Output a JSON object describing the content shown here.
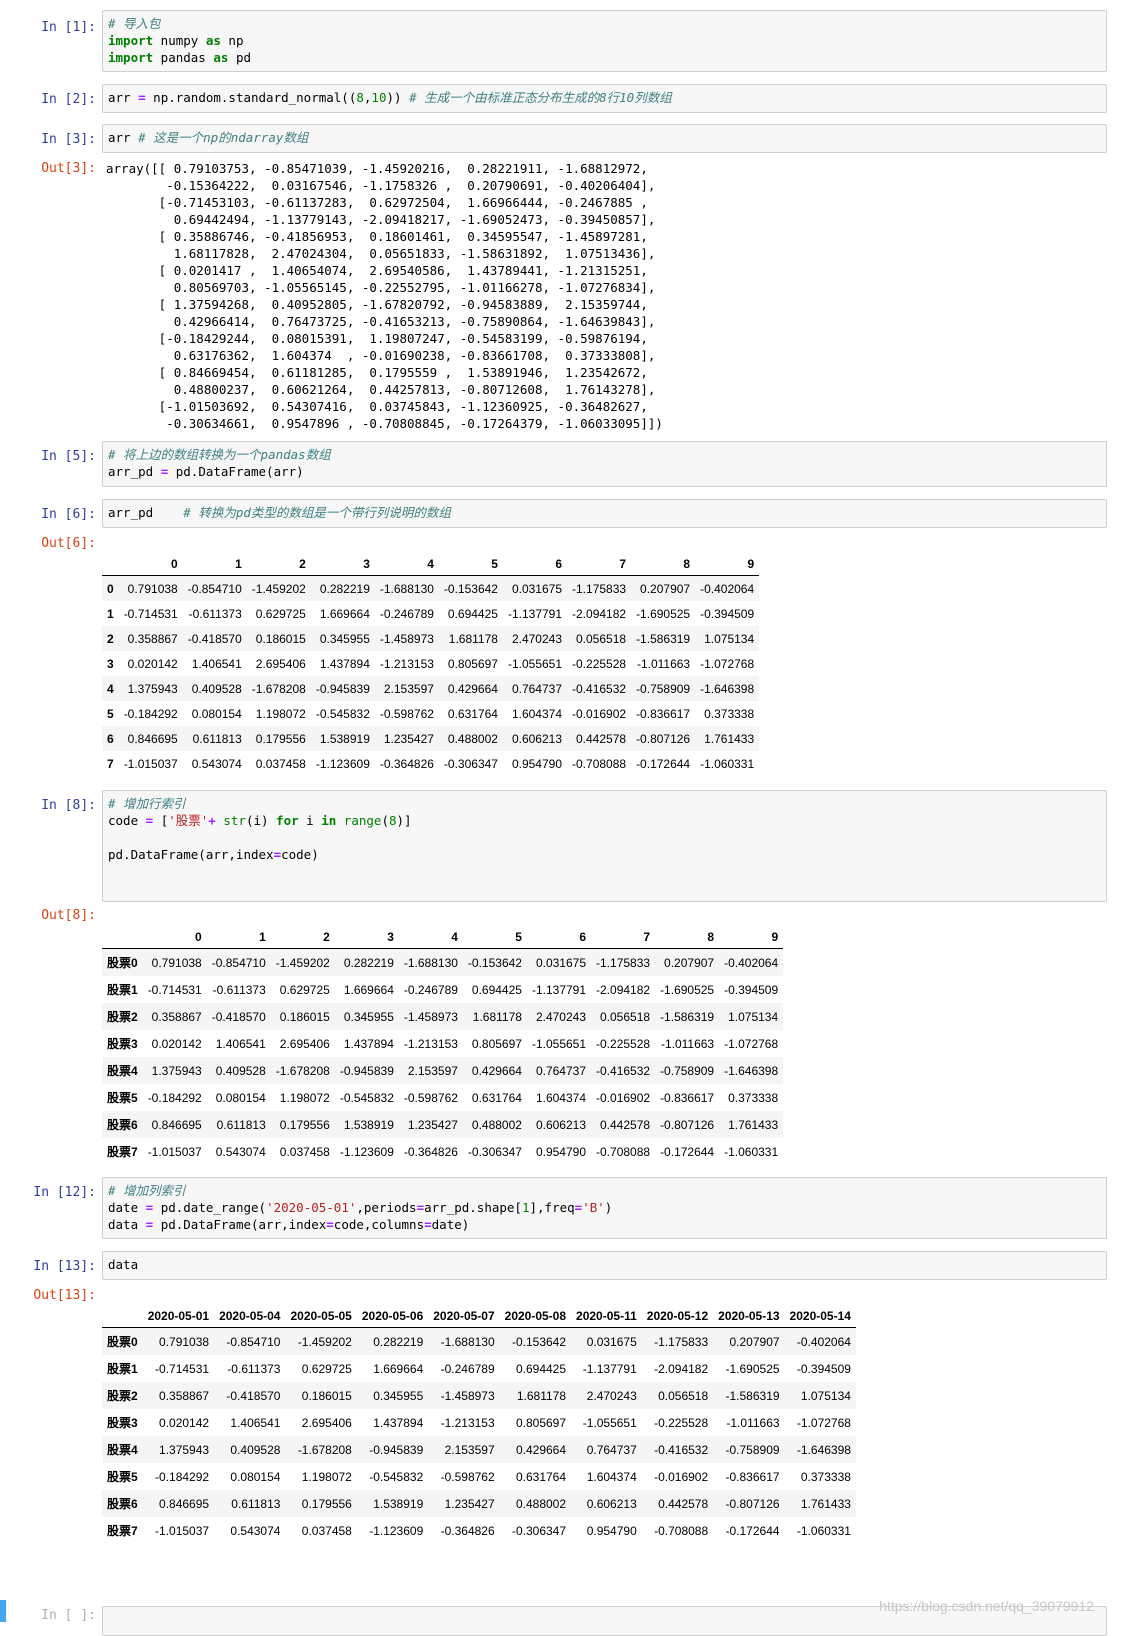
{
  "cells": [
    {
      "prompt": "In  [1]:",
      "lines": [
        "# 导入包",
        "import numpy as np",
        "import pandas as pd"
      ]
    },
    {
      "prompt": "In  [2]:",
      "lines": [
        "arr = np.random.standard_normal((8,10)) # 生成一个由标准正态分布生成的8行10列数组"
      ]
    },
    {
      "prompt": "In  [3]:",
      "lines": [
        "arr # 这是一个np的ndarray数组"
      ],
      "out_prompt": "Out[3]:",
      "output_lines": [
        "array([[ 0.79103753, -0.85471039, -1.45920216,  0.28221911, -1.68812972,",
        "        -0.15364222,  0.03167546, -1.1758326 ,  0.20790691, -0.40206404],",
        "       [-0.71453103, -0.61137283,  0.62972504,  1.66966444, -0.2467885 ,",
        "         0.69442494, -1.13779143, -2.09418217, -1.69052473, -0.39450857],",
        "       [ 0.35886746, -0.41856953,  0.18601461,  0.34595547, -1.45897281,",
        "         1.68117828,  2.47024304,  0.05651833, -1.58631892,  1.07513436],",
        "       [ 0.0201417 ,  1.40654074,  2.69540586,  1.43789441, -1.21315251,",
        "         0.80569703, -1.05565145, -0.22552795, -1.01166278, -1.07276834],",
        "       [ 1.37594268,  0.40952805, -1.67820792, -0.94583889,  2.15359744,",
        "         0.42966414,  0.76473725, -0.41653213, -0.75890864, -1.64639843],",
        "       [-0.18429244,  0.08015391,  1.19807247, -0.54583199, -0.59876194,",
        "         0.63176362,  1.604374  , -0.01690238, -0.83661708,  0.37333808],",
        "       [ 0.84669454,  0.61181285,  0.1795559 ,  1.53891946,  1.23542672,",
        "         0.48800237,  0.60621264,  0.44257813, -0.80712608,  1.76143278],",
        "       [-1.01503692,  0.54307416,  0.03745843, -1.12360925, -0.36482627,",
        "        -0.30634661,  0.9547896 , -0.70808845, -0.17264379, -1.06033095]])"
      ]
    },
    {
      "prompt": "In  [5]:",
      "lines": [
        "# 将上边的数组转换为一个pandas数组",
        "arr_pd = pd.DataFrame(arr)"
      ]
    },
    {
      "prompt": "In  [6]:",
      "lines": [
        "arr_pd    # 转换为pd类型的数组是一个带行列说明的数组"
      ],
      "out_prompt": "Out[6]:"
    },
    {
      "prompt": "In  [8]:",
      "lines": [
        "# 增加行索引",
        "code = ['股票'+ str(i) for i in range(8)]",
        "",
        "pd.DataFrame(arr,index=code)"
      ],
      "out_prompt": "Out[8]:"
    },
    {
      "prompt": "In  [12]:",
      "lines": [
        "# 增加列索引",
        "date = pd.date_range('2020-05-01',periods=arr_pd.shape[1],freq='B')",
        "data = pd.DataFrame(arr,index=code,columns=date)"
      ]
    },
    {
      "prompt": "In  [13]:",
      "lines": [
        "data"
      ],
      "out_prompt": "Out[13]:"
    },
    {
      "prompt": "In  [ ]:"
    }
  ],
  "df_numeric_cols": [
    "0",
    "1",
    "2",
    "3",
    "4",
    "5",
    "6",
    "7",
    "8",
    "9"
  ],
  "df_date_cols": [
    "2020-05-01",
    "2020-05-04",
    "2020-05-05",
    "2020-05-06",
    "2020-05-07",
    "2020-05-08",
    "2020-05-11",
    "2020-05-12",
    "2020-05-13",
    "2020-05-14"
  ],
  "df_numeric_index": [
    "0",
    "1",
    "2",
    "3",
    "4",
    "5",
    "6",
    "7"
  ],
  "df_stock_index": [
    "股票0",
    "股票1",
    "股票2",
    "股票3",
    "股票4",
    "股票5",
    "股票6",
    "股票7"
  ],
  "df_rows": [
    [
      "0.791038",
      "-0.854710",
      "-1.459202",
      "0.282219",
      "-1.688130",
      "-0.153642",
      "0.031675",
      "-1.175833",
      "0.207907",
      "-0.402064"
    ],
    [
      "-0.714531",
      "-0.611373",
      "0.629725",
      "1.669664",
      "-0.246789",
      "0.694425",
      "-1.137791",
      "-2.094182",
      "-1.690525",
      "-0.394509"
    ],
    [
      "0.358867",
      "-0.418570",
      "0.186015",
      "0.345955",
      "-1.458973",
      "1.681178",
      "2.470243",
      "0.056518",
      "-1.586319",
      "1.075134"
    ],
    [
      "0.020142",
      "1.406541",
      "2.695406",
      "1.437894",
      "-1.213153",
      "0.805697",
      "-1.055651",
      "-0.225528",
      "-1.011663",
      "-1.072768"
    ],
    [
      "1.375943",
      "0.409528",
      "-1.678208",
      "-0.945839",
      "2.153597",
      "0.429664",
      "0.764737",
      "-0.416532",
      "-0.758909",
      "-1.646398"
    ],
    [
      "-0.184292",
      "0.080154",
      "1.198072",
      "-0.545832",
      "-0.598762",
      "0.631764",
      "1.604374",
      "-0.016902",
      "-0.836617",
      "0.373338"
    ],
    [
      "0.846695",
      "0.611813",
      "0.179556",
      "1.538919",
      "1.235427",
      "0.488002",
      "0.606213",
      "0.442578",
      "-0.807126",
      "1.761433"
    ],
    [
      "-1.015037",
      "0.543074",
      "0.037458",
      "-1.123609",
      "-0.364826",
      "-0.306347",
      "0.954790",
      "-0.708088",
      "-0.172644",
      "-1.060331"
    ]
  ],
  "watermark": "https://blog.csdn.net/qq_39079912"
}
